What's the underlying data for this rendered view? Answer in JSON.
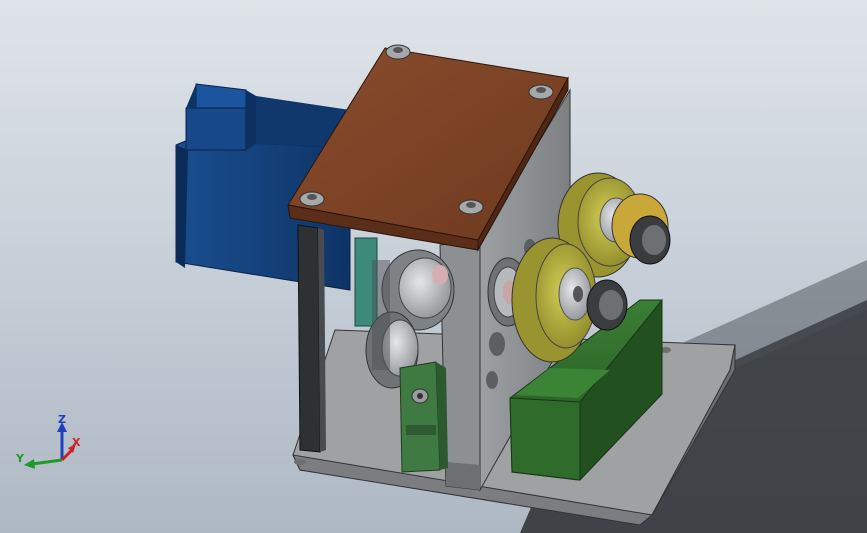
{
  "viewport": {
    "background_top": "#dfe4e9",
    "background_bottom": "#aeb8c3",
    "shadow_color": "#2b2e31"
  },
  "model": {
    "colors": {
      "top_plate": "#7a4226",
      "motor": "#123f78",
      "frame": "#8a8c8e",
      "base_plate": "#9a9c9e",
      "gear_yellow": "#b3ad37",
      "block_green": "#2f6b2a",
      "bracket_green": "#3f7a43",
      "post_dark": "#2e3133",
      "teal_part": "#3c8a7a"
    },
    "icons": [
      "socket-head-screw-icon",
      "spur-gear-icon",
      "roller-icon",
      "bearing-icon"
    ]
  },
  "triad": {
    "labels": {
      "z": "Z",
      "y": "Y",
      "x": "X"
    },
    "colors": {
      "z": "#1f3fbf",
      "y": "#1f9a2a",
      "x": "#cc2222"
    }
  }
}
